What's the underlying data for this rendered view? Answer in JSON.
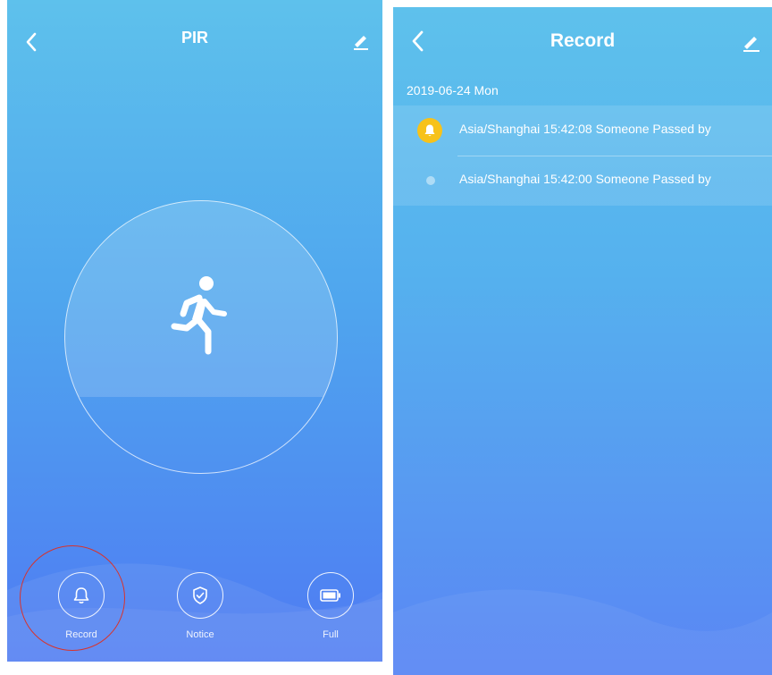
{
  "left_screen": {
    "title": "PIR",
    "controls": [
      {
        "label": "Record",
        "icon": "bell-icon"
      },
      {
        "label": "Notice",
        "icon": "shield-check-icon"
      },
      {
        "label": "Full",
        "icon": "battery-icon"
      }
    ],
    "highlight_color": "#d8332c"
  },
  "right_screen": {
    "title": "Record",
    "date": "2019-06-24  Mon",
    "records": [
      {
        "text": "Asia/Shanghai 15:42:08 Someone Passed by",
        "marker": "bell-icon",
        "marker_color": "#f7c21a"
      },
      {
        "text": "Asia/Shanghai 15:42:00 Someone Passed by",
        "marker": "dot"
      }
    ]
  },
  "colors": {
    "gradient_top": "#5ec1ec",
    "gradient_bottom": "#4f7bf3"
  }
}
